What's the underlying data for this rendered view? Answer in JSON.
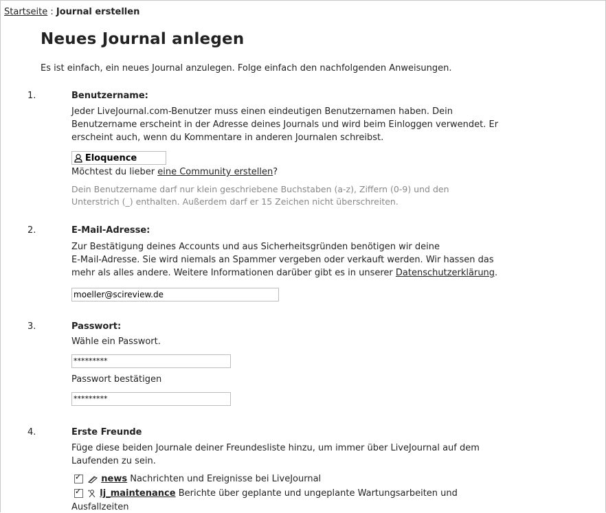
{
  "breadcrumb": {
    "home": "Startseite",
    "sep": " : ",
    "current": "Journal erstellen"
  },
  "page_title": "Neues Journal anlegen",
  "intro": "Es ist einfach, ein neues Journal anzulegen. Folge einfach den nachfolgenden Anweisungen.",
  "steps": [
    {
      "num": "1.",
      "title": "Benutzername:",
      "desc_lines": [
        "Jeder LiveJournal.com-Benutzer muss einen eindeutigen Benutzernamen haben. Dein",
        "Benutzername erscheint in der Adresse deines Journals und wird beim Einloggen verwendet. Er",
        "erscheint auch, wenn du Kommentare in anderen Journalen schreibst."
      ],
      "username_value": "Eloquence",
      "community_prefix": "Möchtest du lieber ",
      "community_link": "eine Community erstellen",
      "community_suffix": "?",
      "help_lines": [
        "Dein Benutzername darf nur klein geschriebene Buchstaben (a-z), Ziffern (0-9) und den",
        "Unterstrich (_) enthalten. Außerdem darf er 15 Zeichen nicht überschreiten."
      ]
    },
    {
      "num": "2.",
      "title": "E-Mail-Adresse:",
      "desc_lines": [
        "Zur Bestätigung deines Accounts und aus Sicherheitsgründen benötigen wir deine",
        "E-Mail-Adresse. Sie wird niemals an Spammer vergeben oder verkauft werden. Wir hassen das",
        "mehr als alles andere. Weitere Informationen darüber gibt es in unserer "
      ],
      "privacy_link": "Datenschutzerklärung",
      "privacy_suffix": ".",
      "email_value": "moeller@scireview.de"
    },
    {
      "num": "3.",
      "title": "Passwort:",
      "choose_label": "Wähle ein Passwort.",
      "password_value": "*********",
      "confirm_label": "Passwort bestätigen",
      "confirm_value": "*********"
    },
    {
      "num": "4.",
      "title": "Erste Freunde",
      "desc_lines": [
        "Füge diese beiden Journale deiner Freundesliste hinzu, um immer über LiveJournal auf dem",
        "Laufenden zu sein."
      ],
      "friends": [
        {
          "name": "news",
          "desc": " Nachrichten und Ereignisse bei LiveJournal",
          "checked": true,
          "icon": "community-icon"
        },
        {
          "name": "lj_maintenance",
          "desc": " Berichte über geplante und ungeplante Wartungsarbeiten und",
          "desc2": "Ausfallzeiten",
          "checked": true,
          "icon": "community-icon"
        }
      ]
    }
  ]
}
